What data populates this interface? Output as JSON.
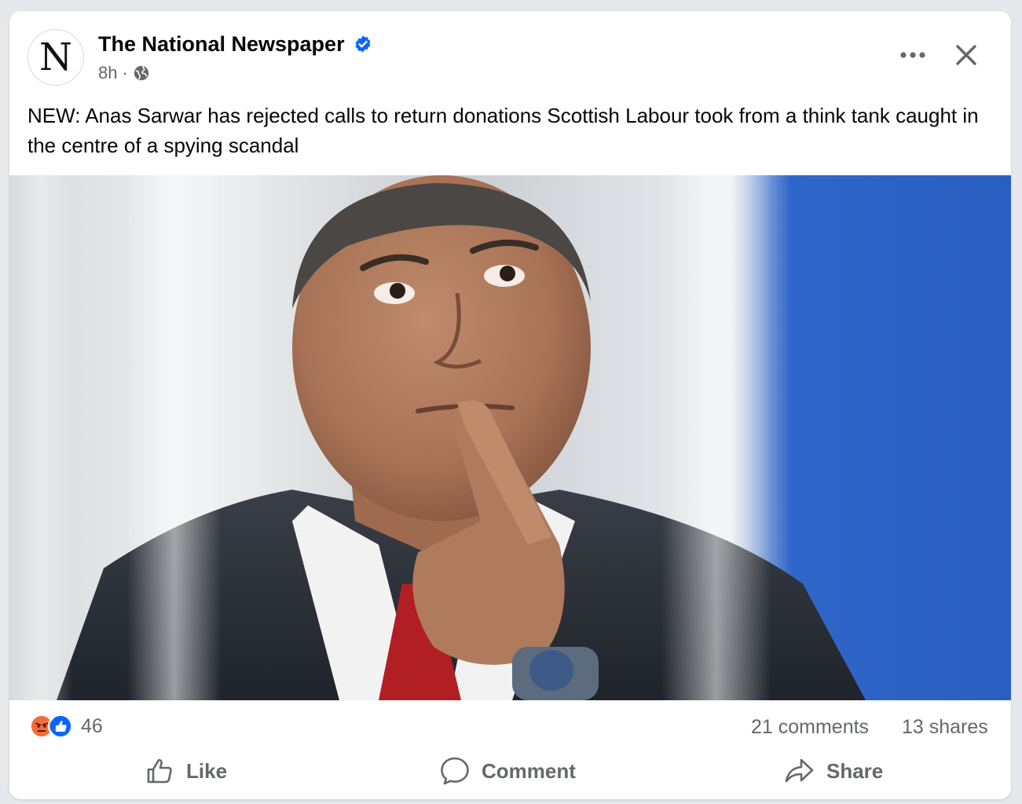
{
  "post": {
    "page_name": "The National Newspaper",
    "avatar_letter": "N",
    "timestamp": "8h",
    "separator": "·",
    "audience_icon": "globe-icon",
    "verified_icon": "verified-badge-icon",
    "text": "NEW: Anas Sarwar has rejected calls to return donations Scottish Labour took from a think tank caught in the centre of a spying scandal"
  },
  "header_controls": {
    "more_icon": "more-options-icon",
    "close_icon": "close-icon"
  },
  "stats": {
    "reactions": [
      "angry",
      "like"
    ],
    "reaction_count": "46",
    "comments": "21 comments",
    "shares": "13 shares"
  },
  "actions": {
    "like": "Like",
    "comment": "Comment",
    "share": "Share"
  },
  "colors": {
    "brand_blue": "#0866ff",
    "secondary_text": "#65676b",
    "primary_text": "#050505",
    "angry": "#f36d3a"
  }
}
